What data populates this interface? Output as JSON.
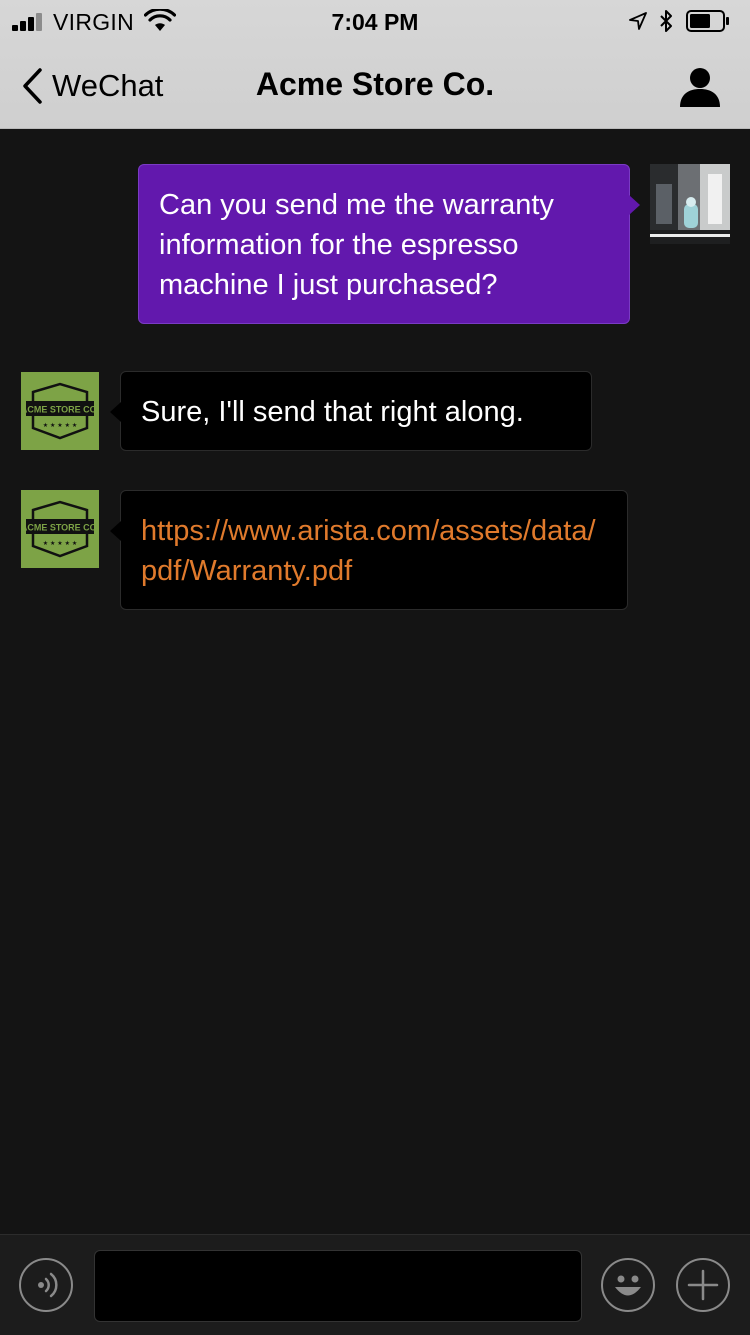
{
  "status_bar": {
    "carrier": "VIRGIN",
    "time": "7:04 PM"
  },
  "nav": {
    "back_label": "WeChat",
    "title": "Acme Store Co."
  },
  "messages": [
    {
      "direction": "outgoing",
      "text": "Can you send me the warranty information for the espresso machine I just purchased?"
    },
    {
      "direction": "incoming",
      "sender_logo_text": "ACME STORE CO.",
      "text": "Sure, I'll send that right along."
    },
    {
      "direction": "incoming",
      "sender_logo_text": "ACME STORE CO.",
      "text": "https://www.arista.com/assets/data/pdf/Warranty.pdf"
    }
  ],
  "input": {
    "value": "",
    "placeholder": ""
  },
  "icons": {
    "voice": "voice-icon",
    "emoji": "emoji-icon",
    "more": "plus-icon",
    "profile": "person-icon"
  },
  "colors": {
    "outgoing_bubble": "#6218ad",
    "incoming_bubble": "#000000",
    "link": "#e07a2c",
    "logo_green": "#7da346"
  }
}
